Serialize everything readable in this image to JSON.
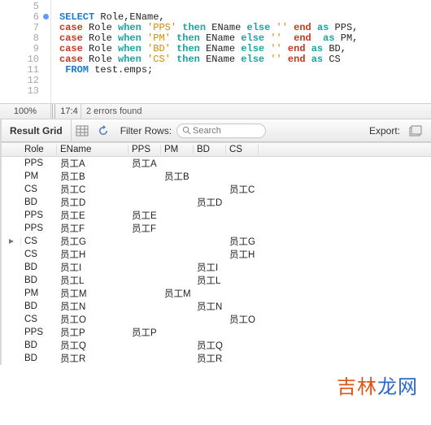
{
  "editor": {
    "lines": [
      5,
      6,
      7,
      8,
      9,
      10,
      11,
      12,
      13
    ],
    "marker_line": 6,
    "code": [
      [],
      [
        {
          "cls": "kw-blue",
          "t": "SELECT"
        },
        {
          "cls": "plain",
          "t": " Role,EName,"
        }
      ],
      [
        {
          "cls": "kw-red",
          "t": "case"
        },
        {
          "cls": "plain",
          "t": " Role "
        },
        {
          "cls": "kw-teal",
          "t": "when"
        },
        {
          "cls": "plain",
          "t": " "
        },
        {
          "cls": "str",
          "t": "'PPS'"
        },
        {
          "cls": "plain",
          "t": " "
        },
        {
          "cls": "kw-teal",
          "t": "then"
        },
        {
          "cls": "plain",
          "t": " EName "
        },
        {
          "cls": "kw-teal",
          "t": "else"
        },
        {
          "cls": "plain",
          "t": " "
        },
        {
          "cls": "str",
          "t": "''"
        },
        {
          "cls": "plain",
          "t": " "
        },
        {
          "cls": "kw-red",
          "t": "end"
        },
        {
          "cls": "plain",
          "t": " "
        },
        {
          "cls": "kw-teal",
          "t": "as"
        },
        {
          "cls": "plain",
          "t": " PPS,"
        }
      ],
      [
        {
          "cls": "kw-red",
          "t": "case"
        },
        {
          "cls": "plain",
          "t": " Role "
        },
        {
          "cls": "kw-teal",
          "t": "when"
        },
        {
          "cls": "plain",
          "t": " "
        },
        {
          "cls": "str",
          "t": "'PM'"
        },
        {
          "cls": "plain",
          "t": " "
        },
        {
          "cls": "kw-teal",
          "t": "then"
        },
        {
          "cls": "plain",
          "t": " EName "
        },
        {
          "cls": "kw-teal",
          "t": "else"
        },
        {
          "cls": "plain",
          "t": " "
        },
        {
          "cls": "str",
          "t": "''"
        },
        {
          "cls": "plain",
          "t": " "
        },
        {
          "cls": "kw-red",
          "t": " end"
        },
        {
          "cls": "plain",
          "t": "  "
        },
        {
          "cls": "kw-teal",
          "t": "as"
        },
        {
          "cls": "plain",
          "t": " PM,"
        }
      ],
      [
        {
          "cls": "kw-red",
          "t": "case"
        },
        {
          "cls": "plain",
          "t": " Role "
        },
        {
          "cls": "kw-teal",
          "t": "when"
        },
        {
          "cls": "plain",
          "t": " "
        },
        {
          "cls": "str",
          "t": "'BD'"
        },
        {
          "cls": "plain",
          "t": " "
        },
        {
          "cls": "kw-teal",
          "t": "then"
        },
        {
          "cls": "plain",
          "t": " EName "
        },
        {
          "cls": "kw-teal",
          "t": "else"
        },
        {
          "cls": "plain",
          "t": " "
        },
        {
          "cls": "str",
          "t": "''"
        },
        {
          "cls": "plain",
          "t": " "
        },
        {
          "cls": "kw-red",
          "t": "end"
        },
        {
          "cls": "plain",
          "t": " "
        },
        {
          "cls": "kw-teal",
          "t": "as"
        },
        {
          "cls": "plain",
          "t": " BD,"
        }
      ],
      [
        {
          "cls": "kw-red",
          "t": "case"
        },
        {
          "cls": "plain",
          "t": " Role "
        },
        {
          "cls": "kw-teal",
          "t": "when"
        },
        {
          "cls": "plain",
          "t": " "
        },
        {
          "cls": "str",
          "t": "'CS'"
        },
        {
          "cls": "plain",
          "t": " "
        },
        {
          "cls": "kw-teal",
          "t": "then"
        },
        {
          "cls": "plain",
          "t": " EName "
        },
        {
          "cls": "kw-teal",
          "t": "else"
        },
        {
          "cls": "plain",
          "t": " "
        },
        {
          "cls": "str",
          "t": "''"
        },
        {
          "cls": "plain",
          "t": " "
        },
        {
          "cls": "kw-red",
          "t": "end"
        },
        {
          "cls": "plain",
          "t": " "
        },
        {
          "cls": "kw-teal",
          "t": "as"
        },
        {
          "cls": "plain",
          "t": " CS"
        }
      ],
      [
        {
          "cls": "plain",
          "t": " "
        },
        {
          "cls": "kw-blue",
          "t": "FROM"
        },
        {
          "cls": "plain",
          "t": " test.emps;"
        }
      ],
      [],
      []
    ]
  },
  "status": {
    "zoom": "100%",
    "pos": "17:4",
    "errors": "2 errors found"
  },
  "toolbar": {
    "tab": "Result Grid",
    "filter_label": "Filter Rows:",
    "search_placeholder": "Search",
    "export_label": "Export:"
  },
  "grid": {
    "columns": [
      "Role",
      "EName",
      "PPS",
      "PM",
      "BD",
      "CS"
    ],
    "selected_row_index": 6,
    "selected_col": "BD",
    "rows": [
      {
        "Role": "PPS",
        "EName": "员工A",
        "PPS": "员工A",
        "PM": "",
        "BD": "",
        "CS": ""
      },
      {
        "Role": "PM",
        "EName": "员工B",
        "PPS": "",
        "PM": "员工B",
        "BD": "",
        "CS": ""
      },
      {
        "Role": "CS",
        "EName": "员工C",
        "PPS": "",
        "PM": "",
        "BD": "",
        "CS": "员工C"
      },
      {
        "Role": "BD",
        "EName": "员工D",
        "PPS": "",
        "PM": "",
        "BD": "员工D",
        "CS": ""
      },
      {
        "Role": "PPS",
        "EName": "员工E",
        "PPS": "员工E",
        "PM": "",
        "BD": "",
        "CS": ""
      },
      {
        "Role": "PPS",
        "EName": "员工F",
        "PPS": "员工F",
        "PM": "",
        "BD": "",
        "CS": ""
      },
      {
        "Role": "CS",
        "EName": "员工G",
        "PPS": "",
        "PM": "",
        "BD": "",
        "CS": "员工G"
      },
      {
        "Role": "CS",
        "EName": "员工H",
        "PPS": "",
        "PM": "",
        "BD": "",
        "CS": "员工H"
      },
      {
        "Role": "BD",
        "EName": "员工I",
        "PPS": "",
        "PM": "",
        "BD": "员工I",
        "CS": ""
      },
      {
        "Role": "BD",
        "EName": "员工L",
        "PPS": "",
        "PM": "",
        "BD": "员工L",
        "CS": ""
      },
      {
        "Role": "PM",
        "EName": "员工M",
        "PPS": "",
        "PM": "员工M",
        "BD": "",
        "CS": ""
      },
      {
        "Role": "BD",
        "EName": "员工N",
        "PPS": "",
        "PM": "",
        "BD": "员工N",
        "CS": ""
      },
      {
        "Role": "CS",
        "EName": "员工O",
        "PPS": "",
        "PM": "",
        "BD": "",
        "CS": "员工O"
      },
      {
        "Role": "PPS",
        "EName": "员工P",
        "PPS": "员工P",
        "PM": "",
        "BD": "",
        "CS": ""
      },
      {
        "Role": "BD",
        "EName": "员工Q",
        "PPS": "",
        "PM": "",
        "BD": "员工Q",
        "CS": ""
      },
      {
        "Role": "BD",
        "EName": "员工R",
        "PPS": "",
        "PM": "",
        "BD": "员工R",
        "CS": ""
      }
    ]
  },
  "watermark": {
    "a": "吉林",
    "b": "龙网"
  }
}
